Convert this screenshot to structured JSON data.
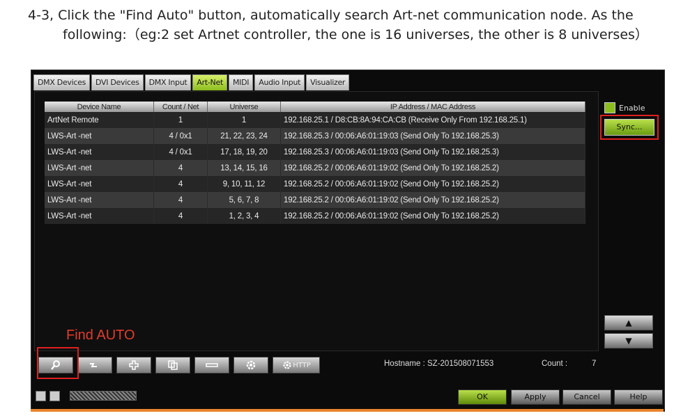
{
  "instruction": {
    "line1": "4-3, Click the \"Find Auto\" button, automatically search Art-net communication node. As the",
    "line2": "following:（eg:2 set Artnet controller, the one is 16 universes, the other is 8 universes）"
  },
  "tabs": [
    {
      "label": "DMX Devices",
      "active": false
    },
    {
      "label": "DVI Devices",
      "active": false
    },
    {
      "label": "DMX Input",
      "active": false
    },
    {
      "label": "Art-Net",
      "active": true
    },
    {
      "label": "MIDI",
      "active": false
    },
    {
      "label": "Audio Input",
      "active": false
    },
    {
      "label": "Visualizer",
      "active": false
    }
  ],
  "table": {
    "headers": [
      "Device Name",
      "Count / Net",
      "Universe",
      "IP Address / MAC Address"
    ],
    "rows": [
      [
        "ArtNet Remote",
        "1",
        "1",
        "192.168.25.1 / D8:CB:8A:94:CA:CB (Receive Only From 192.168.25.1)"
      ],
      [
        "LWS-Art -net",
        "4 / 0x1",
        "21, 22, 23, 24",
        "192.168.25.3 / 00:06:A6:01:19:03 (Send Only To 192.168.25.3)"
      ],
      [
        "LWS-Art -net",
        "4 / 0x1",
        "17, 18, 19, 20",
        "192.168.25.3 / 00:06:A6:01:19:03 (Send Only To 192.168.25.3)"
      ],
      [
        "LWS-Art -net",
        "4",
        "13, 14, 15, 16",
        "192.168.25.2 / 00:06:A6:01:19:02 (Send Only To 192.168.25.2)"
      ],
      [
        "LWS-Art -net",
        "4",
        "9, 10, 11, 12",
        "192.168.25.2 / 00:06:A6:01:19:02 (Send Only To 192.168.25.2)"
      ],
      [
        "LWS-Art -net",
        "4",
        "5, 6, 7, 8",
        "192.168.25.2 / 00:06:A6:01:19:02 (Send Only To 192.168.25.2)"
      ],
      [
        "LWS-Art -net",
        "4",
        "1, 2, 3, 4",
        "192.168.25.2 / 00:06:A6:01:19:02 (Send Only To 192.168.25.2)"
      ]
    ]
  },
  "side": {
    "enable_label": "Enable",
    "enable_checked": true,
    "sync_label": "Sync..."
  },
  "arrows": {
    "up": "▲",
    "down": "▼"
  },
  "toolbar": {
    "http_label": "HTTP"
  },
  "find_auto_label": "Find AUTO",
  "status": {
    "hostname": "Hostname : SZ-201508071553",
    "count_label": "Count :",
    "count_value": "7"
  },
  "buttons": {
    "ok": "OK",
    "apply": "Apply",
    "cancel": "Cancel",
    "help": "Help"
  },
  "colors": {
    "accent": "#8cbd1f",
    "highlight_box": "#e02020",
    "orange_strip": "#e8852a"
  }
}
